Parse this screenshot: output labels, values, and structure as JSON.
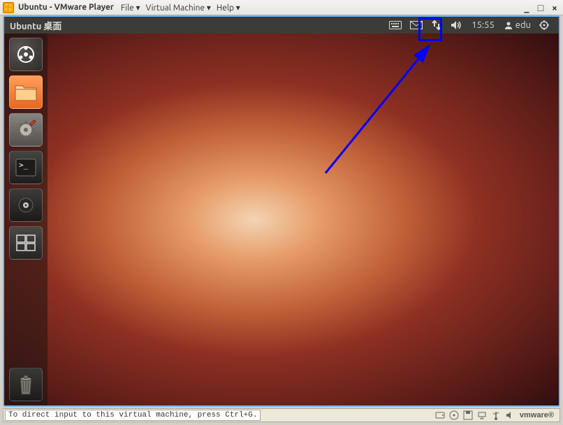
{
  "vmware": {
    "title_prefix": "Ubuntu",
    "title_app": "VMware Player",
    "menu": [
      "File ▾",
      "Virtual Machine ▾",
      "Help ▾"
    ],
    "window_buttons": {
      "min": "_",
      "max": "□",
      "close": "×"
    },
    "status_message": "To direct input to this virtual machine, press Ctrl+G.",
    "brand": "vmware"
  },
  "ubuntu": {
    "topbar": {
      "app_title": "Ubuntu 桌面",
      "time": "15:55",
      "user": "edu"
    },
    "launcher": {
      "items": [
        {
          "name": "dash",
          "label": "Dash Home"
        },
        {
          "name": "files",
          "label": "Files"
        },
        {
          "name": "settings",
          "label": "System Settings"
        },
        {
          "name": "terminal",
          "label": "Terminal"
        },
        {
          "name": "software",
          "label": "Ubuntu Software Center"
        },
        {
          "name": "workspace",
          "label": "Workspace Switcher"
        }
      ],
      "trash_label": "Trash"
    }
  },
  "annotation": {
    "highlight_target": "network-indicator"
  }
}
